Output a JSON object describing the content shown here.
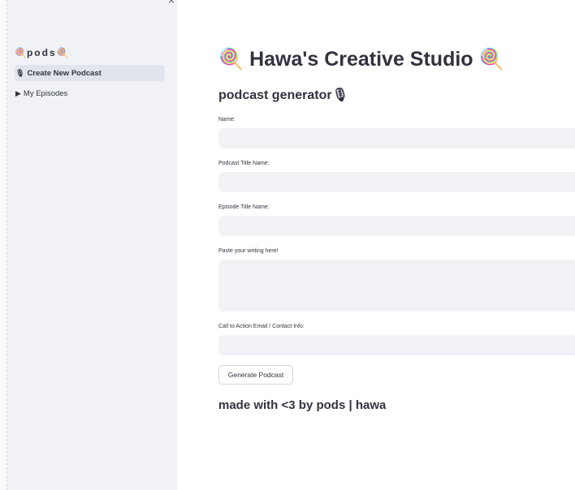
{
  "sidebar": {
    "close_glyph": "×",
    "title_emoji": "🍭",
    "title_text": "pods",
    "nav": [
      {
        "icon": "🎙",
        "label": "Create New Podcast",
        "active": true
      },
      {
        "icon": "▶",
        "label": "My Episodes",
        "active": false
      }
    ]
  },
  "main": {
    "title_emoji": "🍭",
    "title_text": "Hawa's Creative Studio",
    "subtitle_text": "podcast generator",
    "subtitle_emoji": "🎙",
    "fields": [
      {
        "label": "Name:",
        "value": ""
      },
      {
        "label": "Podcast Title Name:",
        "value": ""
      },
      {
        "label": "Episode Title Name:",
        "value": ""
      },
      {
        "label": "Paste your writing here!",
        "value": ""
      },
      {
        "label": "Call to Action Email / Contact Info:",
        "value": ""
      }
    ],
    "generate_button": "Generate Podcast",
    "footer": "made with <3 by pods | hawa"
  },
  "colors": {
    "sidebar_bg": "#f0f2f6",
    "input_bg": "#f0f2f6",
    "text": "#31333f",
    "active_nav_bg": "#e1e4ec"
  }
}
